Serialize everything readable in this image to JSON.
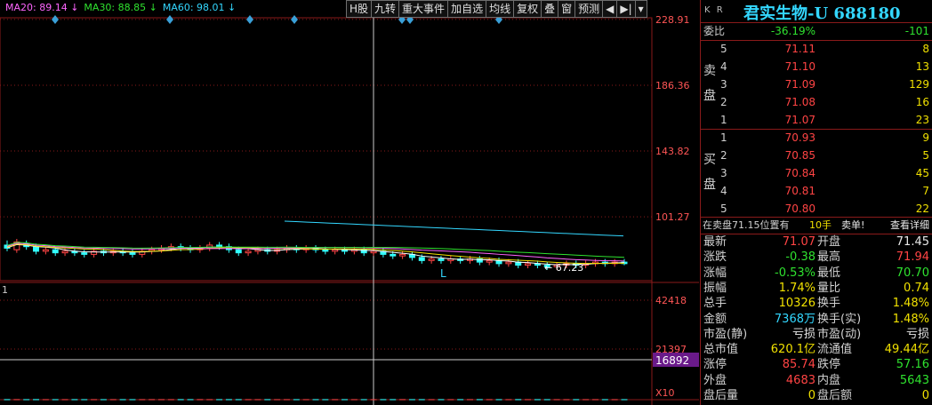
{
  "ma_bar": [
    {
      "label": "MA20: 89.14",
      "color": "#ff66ff"
    },
    {
      "label": "MA30: 88.85",
      "color": "#2fe22f"
    },
    {
      "label": "MA60: 98.01",
      "color": "#33d7ff"
    }
  ],
  "toolbar": [
    "H股",
    "九转",
    "重大事件",
    "加自选",
    "均线",
    "复权",
    "叠",
    "窗",
    "预测"
  ],
  "price_axis": [
    "228.91",
    "186.36",
    "143.82",
    "101.27"
  ],
  "volume_axis": [
    "42418",
    "21397",
    "16892"
  ],
  "volume_unit": "X10",
  "low_marker": "67.23",
  "cursor_marker": "L",
  "panel_marker": "1",
  "header": {
    "kr": "K R",
    "title": "君实生物-U 688180"
  },
  "weibi": {
    "label": "委比",
    "pct": "-36.19%",
    "diff": "-101"
  },
  "sell_side": "卖\n盘",
  "buy_side": "买\n盘",
  "sell": [
    {
      "lv": "5",
      "price": "71.11",
      "vol": "8"
    },
    {
      "lv": "4",
      "price": "71.10",
      "vol": "13"
    },
    {
      "lv": "3",
      "price": "71.09",
      "vol": "129"
    },
    {
      "lv": "2",
      "price": "71.08",
      "vol": "16"
    },
    {
      "lv": "1",
      "price": "71.07",
      "vol": "23"
    }
  ],
  "buy": [
    {
      "lv": "1",
      "price": "70.93",
      "vol": "9"
    },
    {
      "lv": "2",
      "price": "70.85",
      "vol": "5"
    },
    {
      "lv": "3",
      "price": "70.84",
      "vol": "45"
    },
    {
      "lv": "4",
      "price": "70.81",
      "vol": "7"
    },
    {
      "lv": "5",
      "price": "70.80",
      "vol": "22"
    }
  ],
  "trade_note": {
    "text": "在卖盘71.15位置有",
    "hands": "10手",
    "action": "卖单!",
    "detail": "查看详细"
  },
  "stats": [
    {
      "l1": "最新",
      "v1": "71.07",
      "c1": "red",
      "l2": "开盘",
      "v2": "71.45",
      "c2": "white"
    },
    {
      "l1": "涨跌",
      "v1": "-0.38",
      "c1": "green",
      "l2": "最高",
      "v2": "71.94",
      "c2": "red"
    },
    {
      "l1": "涨幅",
      "v1": "-0.53%",
      "c1": "green",
      "l2": "最低",
      "v2": "70.70",
      "c2": "green"
    },
    {
      "l1": "振幅",
      "v1": "1.74%",
      "c1": "yellow",
      "l2": "量比",
      "v2": "0.74",
      "c2": "yellow"
    },
    {
      "l1": "总手",
      "v1": "10326",
      "c1": "yellow",
      "l2": "换手",
      "v2": "1.48%",
      "c2": "yellow"
    },
    {
      "l1": "金额",
      "v1": "7368万",
      "c1": "cyan",
      "l2": "换手(实)",
      "v2": "1.48%",
      "c2": "yellow"
    },
    {
      "l1": "市盈(静)",
      "v1": "亏损",
      "c1": "white",
      "l2": "市盈(动)",
      "v2": "亏损",
      "c2": "white"
    },
    {
      "l1": "总市值",
      "v1": "620.1亿",
      "c1": "yellow",
      "l2": "流通值",
      "v2": "49.44亿",
      "c2": "yellow"
    },
    {
      "l1": "涨停",
      "v1": "85.74",
      "c1": "red",
      "l2": "跌停",
      "v2": "57.16",
      "c2": "green"
    },
    {
      "l1": "外盘",
      "v1": "4683",
      "c1": "red",
      "l2": "内盘",
      "v2": "5643",
      "c2": "green"
    },
    {
      "l1": "盘后量",
      "v1": "0",
      "c1": "yellow",
      "l2": "盘后额",
      "v2": "0",
      "c2": "yellow"
    }
  ],
  "colors": {
    "up": "#ff4444",
    "down": "#33ffff",
    "grid": "#8a1a1a",
    "ma5": "#ffffff",
    "ma10": "#f0e000",
    "ma20": "#ff66ff",
    "ma30": "#2fe22f",
    "ma60": "#33d7ff"
  },
  "chart_data": {
    "type": "candlestick",
    "ylim": [
      60,
      230
    ],
    "candles": [
      {
        "o": 83,
        "c": 81,
        "h": 86,
        "l": 79
      },
      {
        "o": 80,
        "c": 85,
        "h": 87,
        "l": 78
      },
      {
        "o": 84,
        "c": 82,
        "h": 86,
        "l": 80
      },
      {
        "o": 82,
        "c": 79,
        "h": 84,
        "l": 77
      },
      {
        "o": 79,
        "c": 80,
        "h": 82,
        "l": 77
      },
      {
        "o": 80,
        "c": 78,
        "h": 82,
        "l": 76
      },
      {
        "o": 78,
        "c": 79,
        "h": 81,
        "l": 76
      },
      {
        "o": 79,
        "c": 78,
        "h": 81,
        "l": 76
      },
      {
        "o": 78,
        "c": 77,
        "h": 80,
        "l": 75
      },
      {
        "o": 77,
        "c": 79,
        "h": 81,
        "l": 75
      },
      {
        "o": 79,
        "c": 78,
        "h": 81,
        "l": 76
      },
      {
        "o": 78,
        "c": 79,
        "h": 81,
        "l": 76
      },
      {
        "o": 79,
        "c": 78,
        "h": 81,
        "l": 76
      },
      {
        "o": 78,
        "c": 77,
        "h": 80,
        "l": 75
      },
      {
        "o": 77,
        "c": 79,
        "h": 81,
        "l": 75
      },
      {
        "o": 79,
        "c": 80,
        "h": 82,
        "l": 77
      },
      {
        "o": 80,
        "c": 81,
        "h": 83,
        "l": 78
      },
      {
        "o": 81,
        "c": 82,
        "h": 84,
        "l": 79
      },
      {
        "o": 82,
        "c": 81,
        "h": 84,
        "l": 79
      },
      {
        "o": 81,
        "c": 80,
        "h": 83,
        "l": 78
      },
      {
        "o": 80,
        "c": 81,
        "h": 83,
        "l": 78
      },
      {
        "o": 81,
        "c": 83,
        "h": 85,
        "l": 79
      },
      {
        "o": 83,
        "c": 82,
        "h": 85,
        "l": 80
      },
      {
        "o": 82,
        "c": 80,
        "h": 84,
        "l": 78
      },
      {
        "o": 80,
        "c": 78,
        "h": 82,
        "l": 76
      },
      {
        "o": 78,
        "c": 79,
        "h": 81,
        "l": 76
      },
      {
        "o": 79,
        "c": 80,
        "h": 82,
        "l": 77
      },
      {
        "o": 80,
        "c": 79,
        "h": 82,
        "l": 77
      },
      {
        "o": 79,
        "c": 80,
        "h": 82,
        "l": 77
      },
      {
        "o": 80,
        "c": 81,
        "h": 83,
        "l": 78
      },
      {
        "o": 81,
        "c": 80,
        "h": 83,
        "l": 78
      },
      {
        "o": 80,
        "c": 81,
        "h": 83,
        "l": 78
      },
      {
        "o": 81,
        "c": 80,
        "h": 83,
        "l": 78
      },
      {
        "o": 80,
        "c": 79,
        "h": 82,
        "l": 77
      },
      {
        "o": 79,
        "c": 80,
        "h": 82,
        "l": 77
      },
      {
        "o": 80,
        "c": 79,
        "h": 82,
        "l": 77
      },
      {
        "o": 79,
        "c": 80,
        "h": 82,
        "l": 77
      },
      {
        "o": 80,
        "c": 78,
        "h": 82,
        "l": 76
      },
      {
        "o": 78,
        "c": 79,
        "h": 81,
        "l": 76
      },
      {
        "o": 79,
        "c": 77,
        "h": 81,
        "l": 75
      },
      {
        "o": 77,
        "c": 76,
        "h": 79,
        "l": 74
      },
      {
        "o": 76,
        "c": 77,
        "h": 79,
        "l": 74
      },
      {
        "o": 77,
        "c": 75,
        "h": 79,
        "l": 73
      },
      {
        "o": 75,
        "c": 73,
        "h": 77,
        "l": 71
      },
      {
        "o": 73,
        "c": 74,
        "h": 76,
        "l": 71
      },
      {
        "o": 74,
        "c": 73,
        "h": 76,
        "l": 71
      },
      {
        "o": 73,
        "c": 74,
        "h": 76,
        "l": 71
      },
      {
        "o": 74,
        "c": 73,
        "h": 76,
        "l": 71
      },
      {
        "o": 73,
        "c": 74,
        "h": 76,
        "l": 71
      },
      {
        "o": 74,
        "c": 72,
        "h": 76,
        "l": 70
      },
      {
        "o": 72,
        "c": 73,
        "h": 75,
        "l": 70
      },
      {
        "o": 73,
        "c": 71,
        "h": 75,
        "l": 69
      },
      {
        "o": 71,
        "c": 72,
        "h": 74,
        "l": 69
      },
      {
        "o": 72,
        "c": 70,
        "h": 74,
        "l": 68
      },
      {
        "o": 70,
        "c": 71,
        "h": 73,
        "l": 68
      },
      {
        "o": 71,
        "c": 70,
        "h": 73,
        "l": 68
      },
      {
        "o": 70,
        "c": 69,
        "h": 72,
        "l": 67
      },
      {
        "o": 69,
        "c": 70,
        "h": 72,
        "l": 67
      },
      {
        "o": 70,
        "c": 71,
        "h": 73,
        "l": 68
      },
      {
        "o": 71,
        "c": 70,
        "h": 73,
        "l": 68
      },
      {
        "o": 70,
        "c": 71,
        "h": 73,
        "l": 68
      },
      {
        "o": 71,
        "c": 72,
        "h": 74,
        "l": 69
      },
      {
        "o": 72,
        "c": 71,
        "h": 74,
        "l": 69
      },
      {
        "o": 71,
        "c": 72,
        "h": 74,
        "l": 69
      },
      {
        "o": 72,
        "c": 71,
        "h": 74,
        "l": 70
      }
    ],
    "volume": [
      20,
      25,
      15,
      30,
      14,
      12,
      18,
      20,
      11,
      16,
      13,
      19,
      15,
      12,
      17,
      22,
      18,
      14,
      20,
      16,
      25,
      15,
      13,
      21,
      19,
      16,
      14,
      18,
      12,
      17,
      15,
      13,
      16,
      14,
      19,
      17,
      13,
      15,
      12,
      18,
      20,
      26,
      15,
      18,
      14,
      16,
      13,
      17,
      19,
      21,
      17,
      15,
      14,
      29,
      18,
      16,
      13,
      15,
      14,
      17,
      16,
      18,
      14,
      15,
      13
    ],
    "volume_max": 42418
  }
}
